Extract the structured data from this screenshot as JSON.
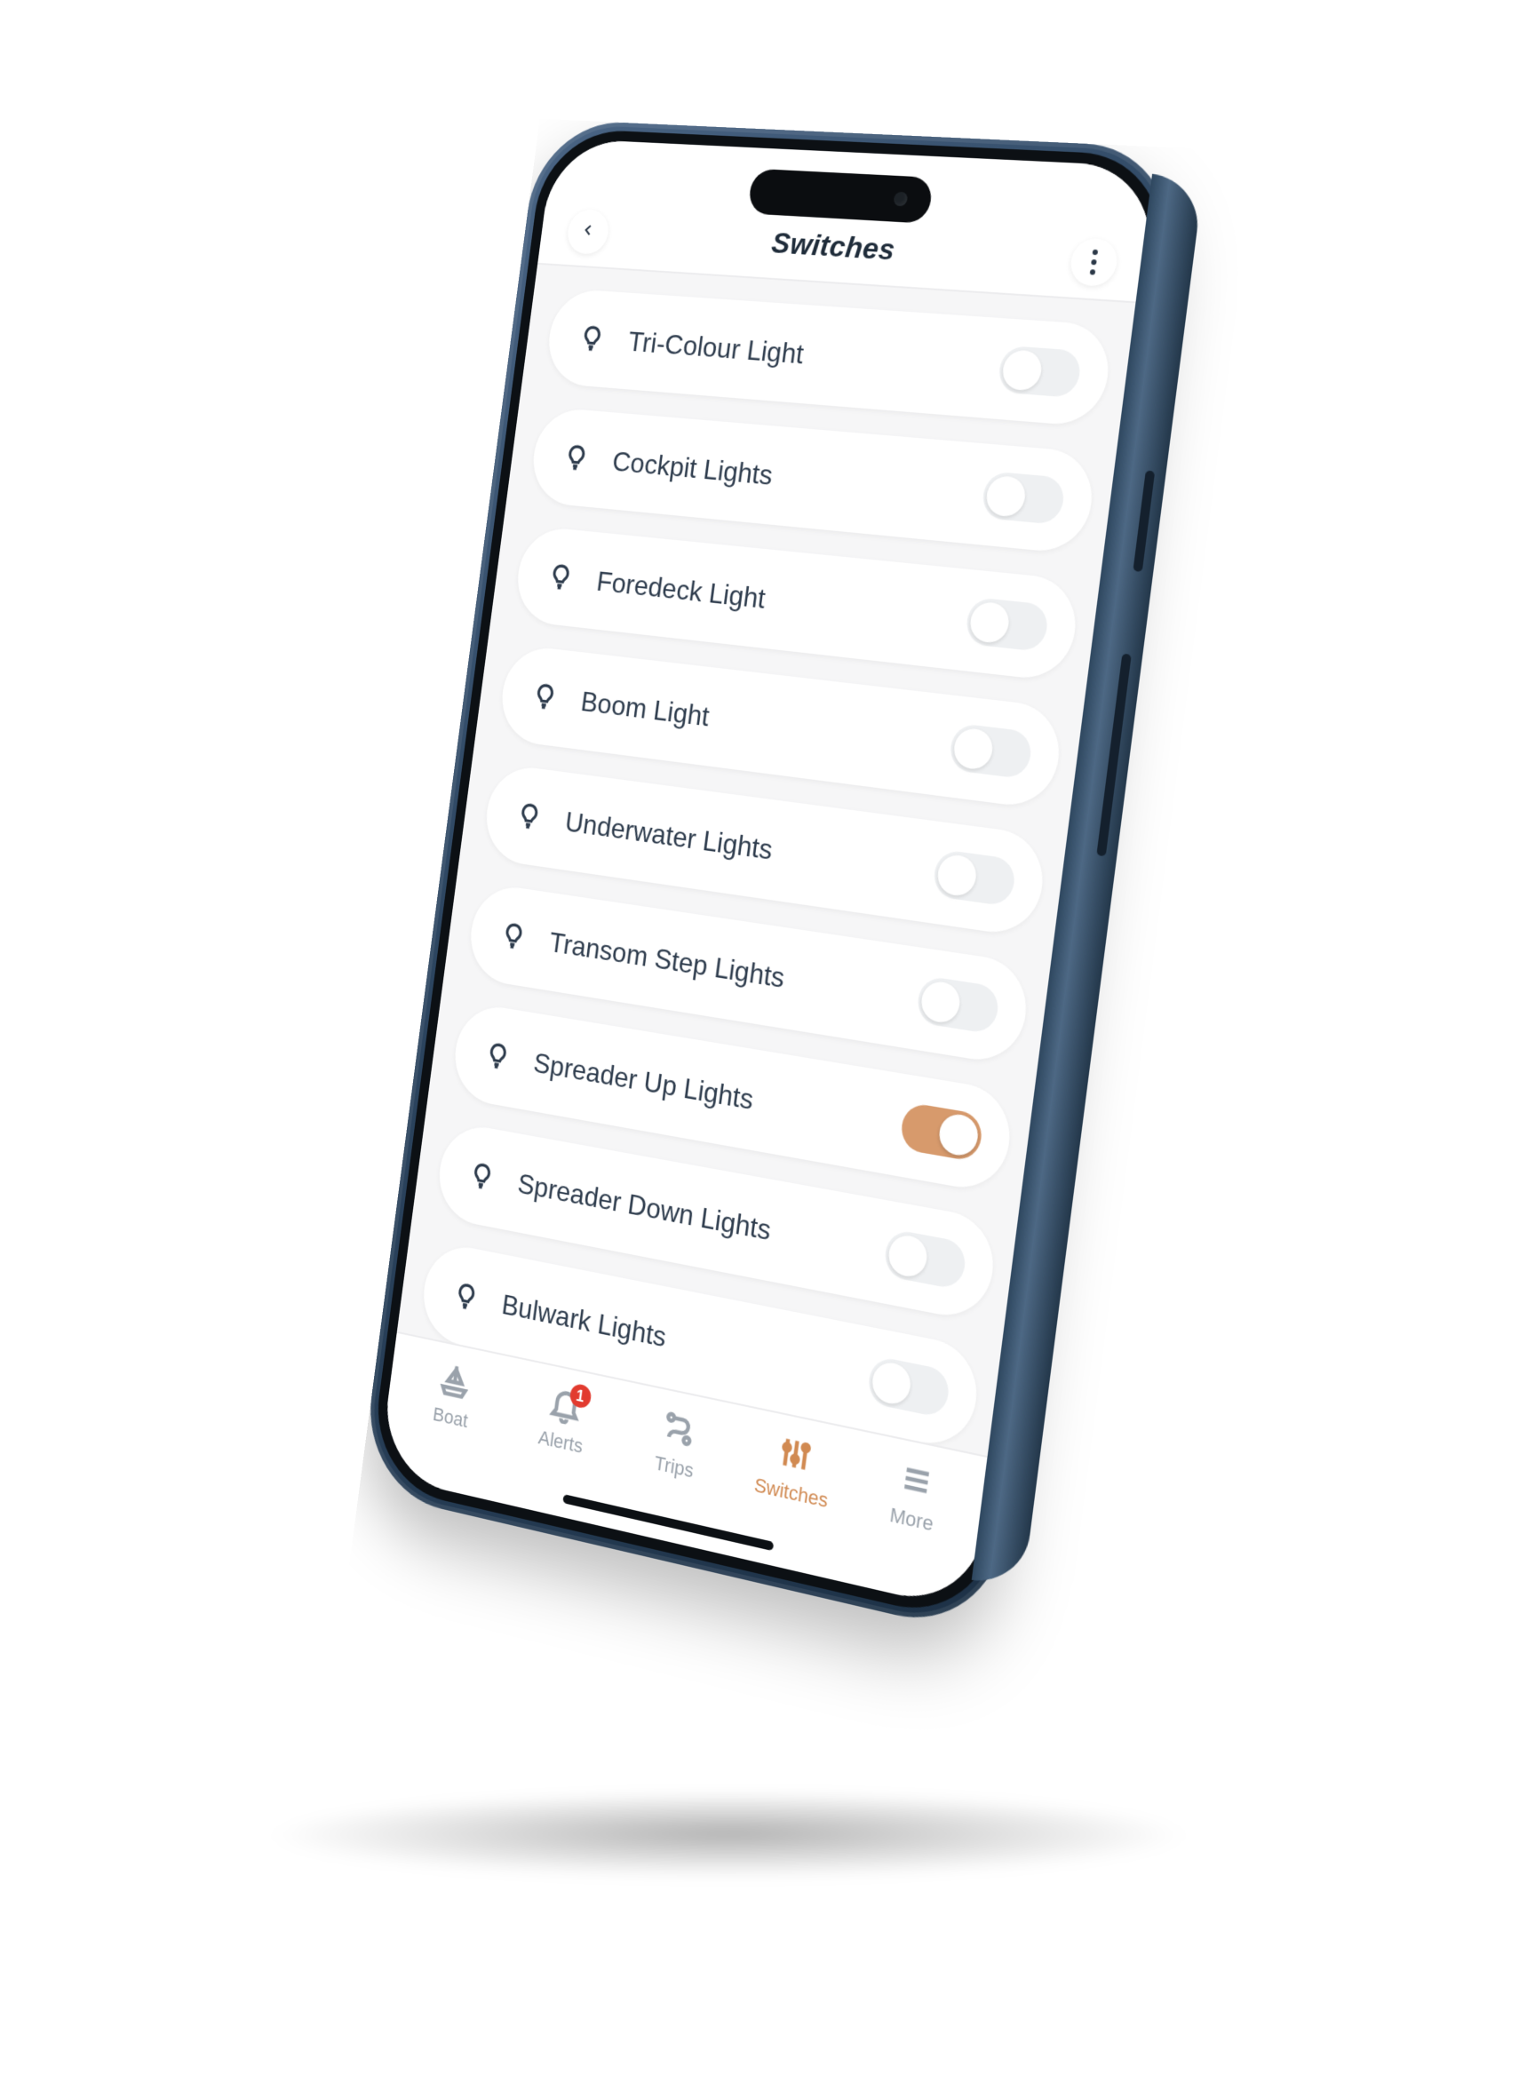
{
  "header": {
    "title": "Switches"
  },
  "switches": [
    {
      "label": "Tri-Colour Light",
      "on": false
    },
    {
      "label": "Cockpit Lights",
      "on": false
    },
    {
      "label": "Foredeck Light",
      "on": false
    },
    {
      "label": "Boom Light",
      "on": false
    },
    {
      "label": "Underwater Lights",
      "on": false
    },
    {
      "label": "Transom Step Lights",
      "on": false
    },
    {
      "label": "Spreader Up Lights",
      "on": true
    },
    {
      "label": "Spreader Down Lights",
      "on": false
    },
    {
      "label": "Bulwark Lights",
      "on": false
    }
  ],
  "nav": {
    "items": [
      {
        "id": "boat",
        "label": "Boat",
        "active": false,
        "badge": null
      },
      {
        "id": "alerts",
        "label": "Alerts",
        "active": false,
        "badge": "1"
      },
      {
        "id": "trips",
        "label": "Trips",
        "active": false,
        "badge": null
      },
      {
        "id": "switches",
        "label": "Switches",
        "active": true,
        "badge": null
      },
      {
        "id": "more",
        "label": "More",
        "active": false,
        "badge": null
      }
    ]
  },
  "colors": {
    "accent": "#d18a52",
    "badge": "#e23b2f",
    "text": "#2e3c4d"
  }
}
